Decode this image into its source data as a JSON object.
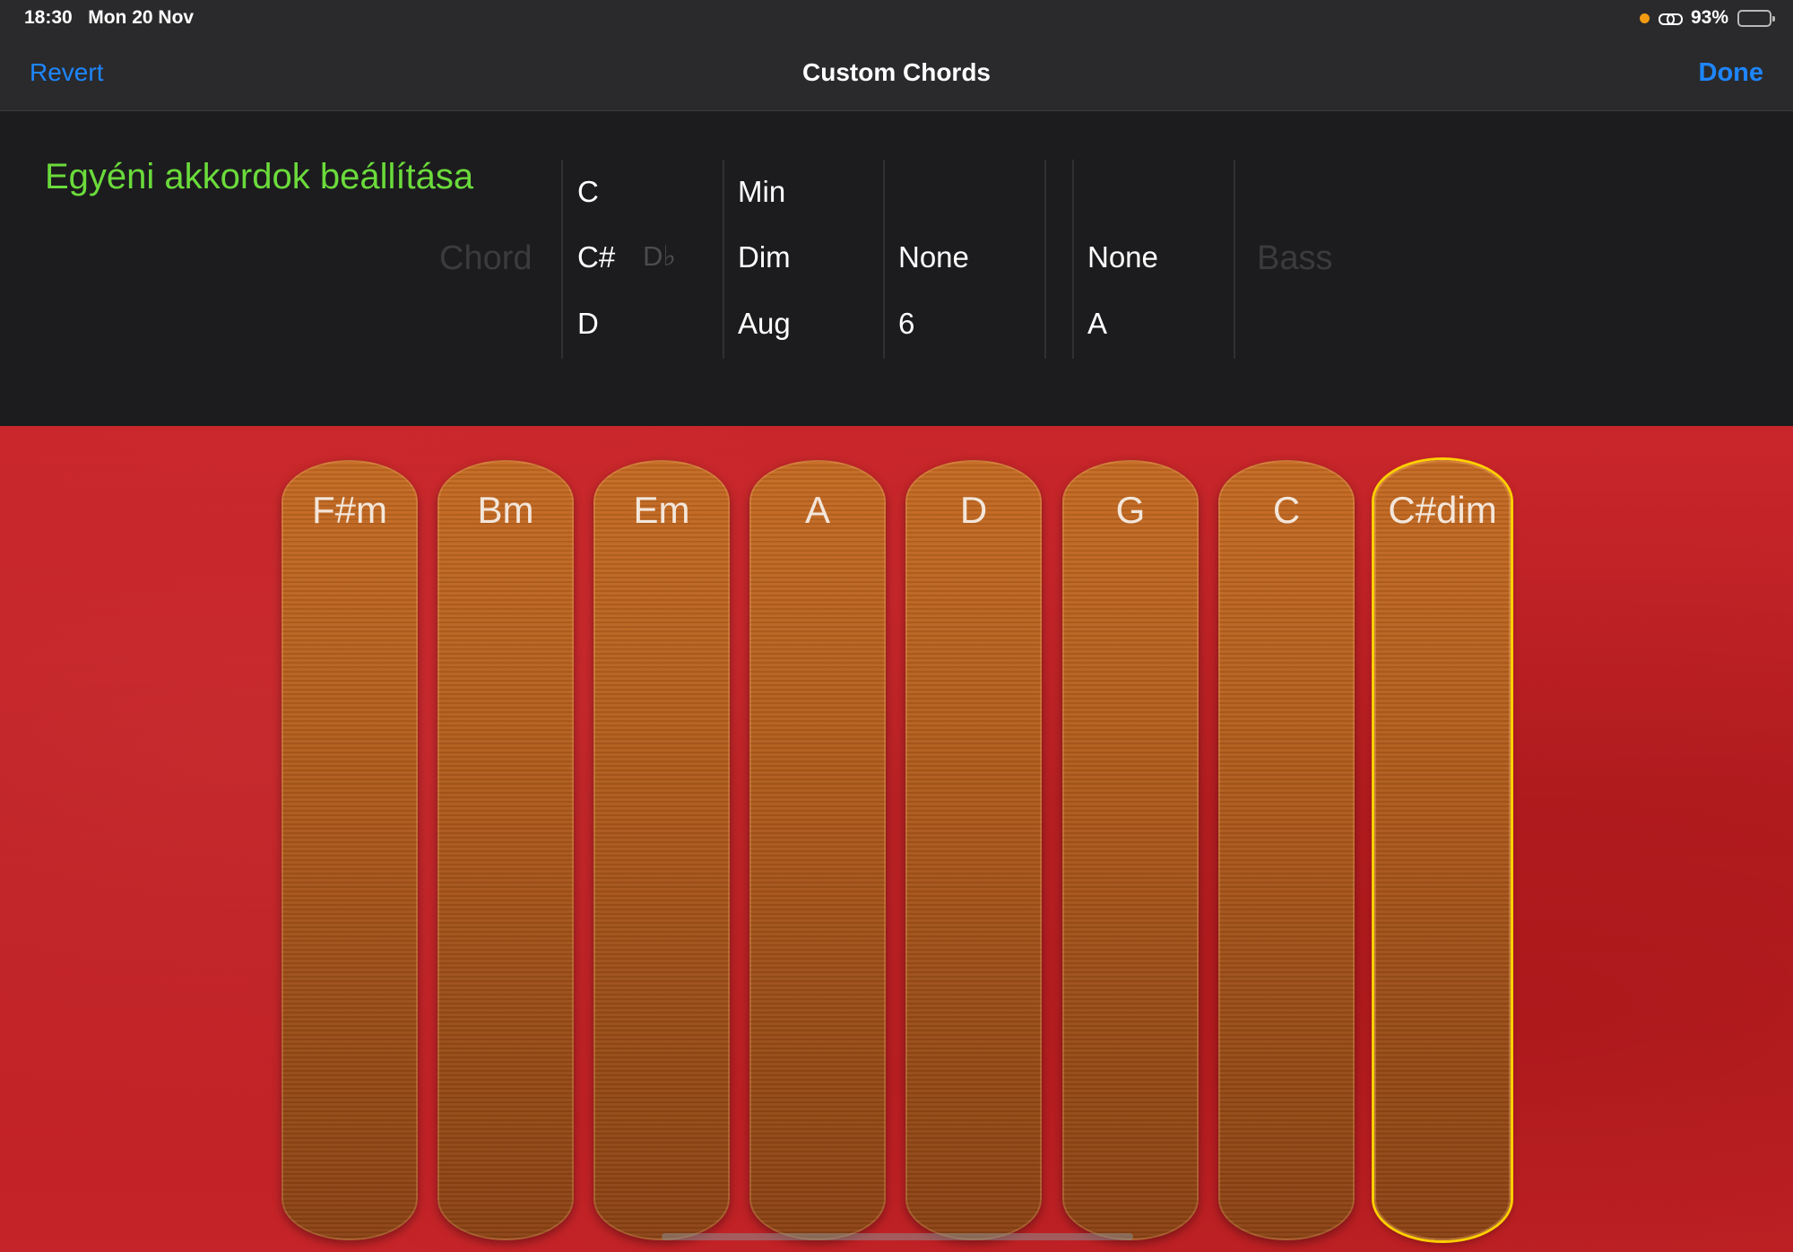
{
  "status_bar": {
    "time": "18:30",
    "date": "Mon 20 Nov",
    "battery_percent": "93%",
    "battery_level": 0.93,
    "indicator_color": "#f39c12"
  },
  "nav": {
    "revert": "Revert",
    "title": "Custom Chords",
    "done": "Done",
    "accent": "#1e86ff"
  },
  "editor": {
    "heading": "Egyéni akkordok beállítása",
    "chord_label": "Chord",
    "bass_label": "Bass",
    "root_column": {
      "above": "C",
      "selected": "C#",
      "selected_alt": "D♭",
      "below": "D"
    },
    "quality_column": {
      "above": "Min",
      "selected": "Dim",
      "below": "Aug"
    },
    "extension_column": {
      "selected": "None",
      "below": "6"
    },
    "bass_column": {
      "selected": "None",
      "below": "A"
    }
  },
  "strips": [
    {
      "label": "F#m"
    },
    {
      "label": "Bm"
    },
    {
      "label": "Em"
    },
    {
      "label": "A"
    },
    {
      "label": "D"
    },
    {
      "label": "G"
    },
    {
      "label": "C"
    },
    {
      "label": "C#dim"
    }
  ],
  "selected_strip_index": 7,
  "colors": {
    "heading_green": "#6bdb3b",
    "background_red": "#c8262a",
    "strip_wood": "#b35e1d",
    "selection_yellow": "#ffd000"
  }
}
